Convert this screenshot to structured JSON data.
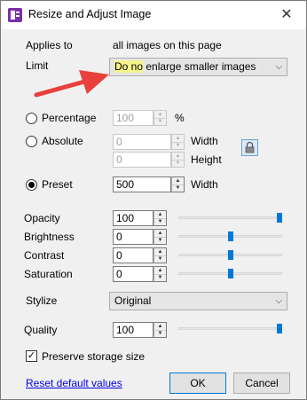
{
  "window": {
    "title": "Resize and Adjust Image",
    "close_glyph": "✕"
  },
  "applies_to": {
    "label": "Applies to",
    "value": "all images on this page"
  },
  "limit": {
    "label": "Limit",
    "value_highlight": "Do no",
    "value_rest": " enlarge smaller images"
  },
  "sizing": {
    "percentage_label": "Percentage",
    "percentage_value": "100",
    "percent_unit": "%",
    "absolute_label": "Absolute",
    "absolute_width": "0",
    "absolute_height": "0",
    "width_label": "Width",
    "height_label": "Height",
    "preset_label": "Preset",
    "preset_value": "500",
    "preset_width_label": "Width",
    "selected": "Preset"
  },
  "adjustments": {
    "opacity_label": "Opacity",
    "opacity_value": "100",
    "opacity_level": 1.0,
    "brightness_label": "Brightness",
    "brightness_value": "0",
    "brightness_level": 0.5,
    "contrast_label": "Contrast",
    "contrast_value": "0",
    "contrast_level": 0.5,
    "saturation_label": "Saturation",
    "saturation_value": "0",
    "saturation_level": 0.5
  },
  "stylize": {
    "label": "Stylize",
    "value": "Original"
  },
  "quality": {
    "label": "Quality",
    "value": "100",
    "level": 1.0
  },
  "preserve": {
    "label": "Preserve storage size",
    "checked": true,
    "check_glyph": "✓"
  },
  "footer": {
    "reset_label": "Reset default values",
    "ok_label": "OK",
    "cancel_label": "Cancel"
  },
  "annotation": {
    "arrow_color": "#e8413b",
    "highlight_color": "#f7f48a"
  },
  "icons": {
    "lock": "lock-icon",
    "app": "onenote-app-icon"
  }
}
